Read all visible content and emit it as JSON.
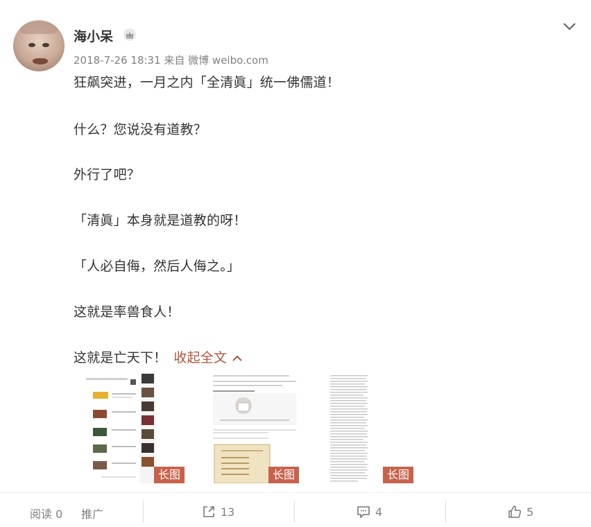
{
  "post": {
    "username": "海小呆",
    "meta": "2018-7-26 18:31 来自 微博 weibo.com",
    "paragraphs": [
      "狂飙突进，一月之内「全清眞」统一佛儒道！",
      "什么？您说没有道教？",
      "外行了吧？",
      "「清眞」本身就是道教的呀！",
      "「人必自侮，然后人侮之。」",
      "这就是率兽食人！",
      "这就是亡天下！"
    ],
    "collapse_label": "收起全文"
  },
  "images": [
    {
      "badge": "长图"
    },
    {
      "badge": "长图"
    },
    {
      "badge": "长图"
    }
  ],
  "footer": {
    "read_label": "阅读 0",
    "promote_label": "推广",
    "share_count": "13",
    "comment_count": "4",
    "like_count": "5"
  },
  "colors": {
    "accent_link": "#b1533a",
    "badge_bg": "#c8624a",
    "meta_text": "#808080"
  }
}
